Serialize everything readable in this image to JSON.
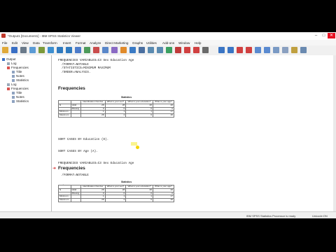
{
  "window": {
    "title": "*Output1 [Document1] - IBM SPSS Statistics Viewer"
  },
  "menu": [
    "File",
    "Edit",
    "View",
    "Data",
    "Transform",
    "Insert",
    "Format",
    "Analyze",
    "Direct Marketing",
    "Graphs",
    "Utilities",
    "Add-ons",
    "Window",
    "Help"
  ],
  "nav": {
    "items": [
      {
        "label": "Output"
      },
      {
        "label": "Log"
      },
      {
        "label": "Frequencies"
      },
      {
        "label": "Title"
      },
      {
        "label": "Notes"
      },
      {
        "label": "Statistics"
      },
      {
        "label": "Log"
      },
      {
        "label": "Frequencies"
      },
      {
        "label": "Title"
      },
      {
        "label": "Notes"
      },
      {
        "label": "Statistics"
      }
    ]
  },
  "output": {
    "syntax1": "FREQUENCIES VARIABLES=C3 Sex Education Age\n  /FORMAT=NOTABLE\n  /STATISTICS=MINIMUM MAXIMUM\n  /ORDER=ANALYSIS.",
    "heading1": "Frequencies",
    "syntax2_lines": [
      "SORT CASES BY Education (D).",
      "SORT CASES BY Age (A).",
      "FREQUENCIES VARIABLES=C3 Sex Education Age",
      "  /FORMAT=NOTABLE",
      "  /STATISTICS=MINIMUM MAXIMUM",
      "  /ORDER=ANALYSIS."
    ],
    "heading2": "Frequencies"
  },
  "statistics_table_1": {
    "title": "Statistics",
    "headers": [
      "",
      "",
      "Identification Number",
      "What is your sex?",
      "What is your education?",
      "What is your age?"
    ],
    "rows": [
      [
        "N",
        "Valid",
        "28",
        "28",
        "28",
        "28"
      ],
      [
        "",
        "Missing",
        "0",
        "0",
        "0",
        "0"
      ],
      [
        "Minimum",
        "",
        "1",
        "1",
        "1",
        "17"
      ],
      [
        "Maximum",
        "",
        "28",
        "2",
        "6",
        "48"
      ]
    ]
  },
  "statistics_table_2": {
    "title": "Statistics",
    "headers": [
      "",
      "",
      "Identification Number",
      "What is your sex?",
      "What is your education?",
      "What is your age?"
    ],
    "rows": [
      [
        "N",
        "Valid",
        "28",
        "28",
        "28",
        "28"
      ],
      [
        "",
        "Missing",
        "0",
        "0",
        "0",
        "0"
      ],
      [
        "Minimum",
        "",
        "1",
        "1",
        "1",
        "17"
      ],
      [
        "Maximum",
        "",
        "28",
        "2",
        "6",
        "48"
      ]
    ]
  },
  "status": {
    "processor": "IBM SPSS Statistics Processor is ready",
    "encoding": "Unicode:ON"
  },
  "colors": {
    "arrow": "#d02020",
    "close_button": "#e81123"
  }
}
